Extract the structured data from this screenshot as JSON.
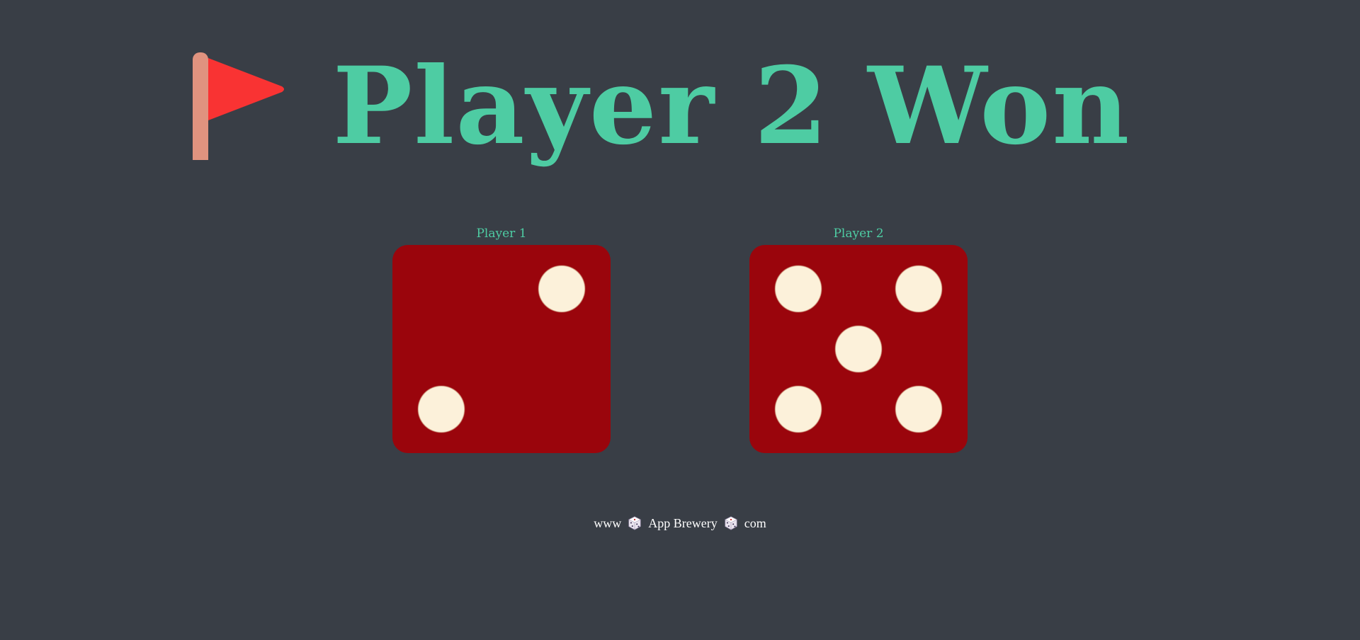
{
  "headline": {
    "icon": "triangular-flag-icon",
    "title": "Player 2 Won",
    "title_color": "#4ECCA3"
  },
  "players": [
    {
      "label": "Player 1",
      "die_value": 2
    },
    {
      "label": "Player 2",
      "die_value": 5
    }
  ],
  "die_colors": {
    "face": "#9A050C",
    "pip": "#FCF1DA"
  },
  "background_color": "#393E46",
  "footer": {
    "left": "www",
    "middle": "App Brewery",
    "right": "com",
    "icon": "game-die-icon"
  }
}
